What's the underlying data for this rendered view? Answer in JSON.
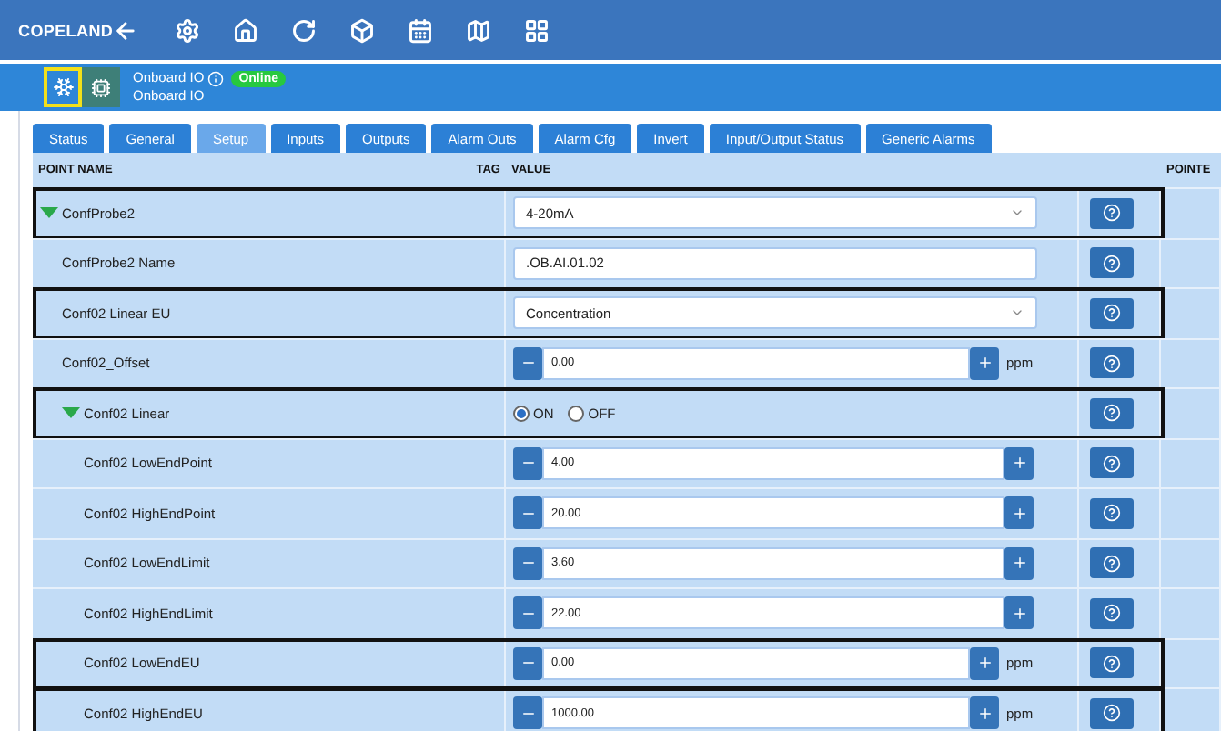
{
  "brand": "COPELAND",
  "device_tiles": [
    {
      "kind": "snowflake",
      "selected": true
    },
    {
      "kind": "chip",
      "selected": false
    }
  ],
  "device": {
    "name": "Onboard IO",
    "status": "Online",
    "subtitle": "Onboard IO"
  },
  "tabs": [
    {
      "label": "Status",
      "selected": false
    },
    {
      "label": "General",
      "selected": false
    },
    {
      "label": "Setup",
      "selected": true
    },
    {
      "label": "Inputs",
      "selected": false
    },
    {
      "label": "Outputs",
      "selected": false
    },
    {
      "label": "Alarm Outs",
      "selected": false
    },
    {
      "label": "Alarm Cfg",
      "selected": false
    },
    {
      "label": "Invert",
      "selected": false
    },
    {
      "label": "Input/Output Status",
      "selected": false
    },
    {
      "label": "Generic Alarms",
      "selected": false
    }
  ],
  "table": {
    "columns": [
      "POINT NAME",
      "TAG",
      "VALUE",
      "POINTE"
    ],
    "rows": [
      {
        "name": "ConfProbe2",
        "kind": "select",
        "value": "4-20mA",
        "highlighted": true,
        "expanded": true,
        "children": [
          {
            "name": "ConfProbe2 Name",
            "kind": "text",
            "value": ".OB.AI.01.02",
            "highlighted": false
          },
          {
            "name": "Conf02 Linear EU",
            "kind": "select",
            "value": "Concentration",
            "highlighted": true
          },
          {
            "name": "Conf02_Offset",
            "kind": "number",
            "value": "0.00",
            "unit": "ppm",
            "highlighted": false
          },
          {
            "name": "Conf02 Linear",
            "kind": "radio",
            "options": [
              {
                "label": "ON",
                "selected": true
              },
              {
                "label": "OFF",
                "selected": false
              }
            ],
            "highlighted": true,
            "expanded": true,
            "children": [
              {
                "name": "Conf02 LowEndPoint",
                "kind": "number",
                "value": "4.00",
                "highlighted": false
              },
              {
                "name": "Conf02 HighEndPoint",
                "kind": "number",
                "value": "20.00",
                "highlighted": false
              },
              {
                "name": "Conf02 LowEndLimit",
                "kind": "number",
                "value": "3.60",
                "highlighted": false
              },
              {
                "name": "Conf02 HighEndLimit",
                "kind": "number",
                "value": "22.00",
                "highlighted": false
              },
              {
                "name": "Conf02 LowEndEU",
                "kind": "number",
                "value": "0.00",
                "unit": "ppm",
                "highlighted": true
              },
              {
                "name": "Conf02 HighEndEU",
                "kind": "number",
                "value": "1000.00",
                "unit": "ppm",
                "highlighted": true
              }
            ]
          }
        ]
      }
    ]
  }
}
